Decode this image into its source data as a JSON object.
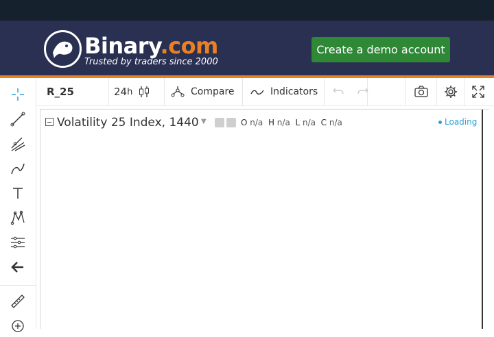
{
  "brand": {
    "name": "Binary",
    "domain_suffix": ".com",
    "tagline": "Trusted by traders since 2000",
    "cta_label": "Create a demo account",
    "colors": {
      "header_bg": "#2a3052",
      "accent": "#e98024",
      "cta_bg": "#2e8836",
      "topbar_bg": "#16212e"
    }
  },
  "toolbar": {
    "symbol": "R_25",
    "timeframe_value": "24",
    "timeframe_unit": "h",
    "compare_label": "Compare",
    "indicators_label": "Indicators",
    "icons": [
      "candlestick-icon",
      "compare-icon",
      "indicators-icon",
      "undo-icon",
      "redo-icon",
      "camera-icon",
      "gear-icon",
      "fullscreen-icon"
    ]
  },
  "drawing_tools": [
    "crosshair-icon",
    "line-tool-icon",
    "fork-tool-icon",
    "brush-tool-icon",
    "text-tool-icon",
    "pattern-tool-icon",
    "fibonacci-tool-icon",
    "back-arrow-icon",
    "ruler-icon",
    "zoom-in-icon"
  ],
  "chart": {
    "title": "Volatility 25 Index, 1440",
    "ohlc": {
      "o_label": "O",
      "o_value": "n/a",
      "h_label": "H",
      "h_value": "n/a",
      "l_label": "L",
      "l_value": "n/a",
      "c_label": "C",
      "c_value": "n/a"
    },
    "status": "Loading"
  }
}
